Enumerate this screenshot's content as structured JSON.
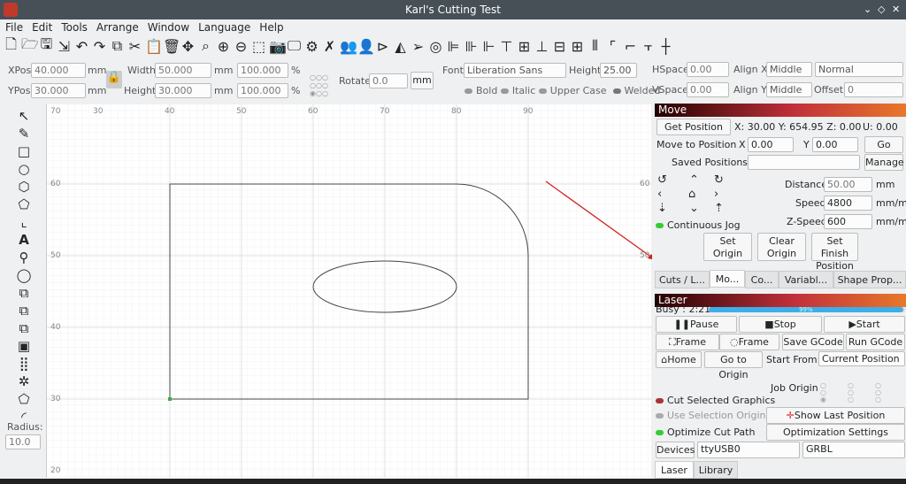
{
  "window": {
    "title": "Karl's Cutting Test"
  },
  "menu": [
    "File",
    "Edit",
    "Tools",
    "Arrange",
    "Window",
    "Language",
    "Help"
  ],
  "toolbar_icons": [
    "new-file-icon",
    "open-folder-icon",
    "save-icon",
    "import-icon",
    "undo-icon",
    "redo-icon",
    "copy-icon",
    "cut-icon",
    "paste-icon",
    "delete-icon",
    "move-icon",
    "zoom-icon",
    "zoom-in-icon",
    "zoom-out-icon",
    "frame-select-icon",
    "camera-icon",
    "monitor-icon",
    "settings-icon",
    "tools-icon",
    "group-icon",
    "user-icon",
    "flip-icon",
    "mirror-icon",
    "send-icon"
  ],
  "props": {
    "xpos_label": "XPos",
    "xpos": "40.000",
    "ypos_label": "YPos",
    "ypos": "30.000",
    "unit": "mm",
    "width_label": "Width",
    "width": "50.000",
    "height_label": "Height",
    "height": "30.000",
    "wpct": "100.000",
    "hpct": "100.000",
    "pct": "%",
    "rotate_label": "Rotate",
    "rotate": "0.0",
    "mm_button": "mm"
  },
  "text": {
    "font_label": "Font",
    "font": "Liberation Sans",
    "height_label": "Height",
    "height": "25.00",
    "hspace_label": "HSpace",
    "hspace": "0.00",
    "vspace_label": "VSpace",
    "vspace": "0.00",
    "alignx_label": "Align X",
    "alignx": "Middle",
    "aligny_label": "Align Y",
    "aligny": "Middle",
    "style": "Normal",
    "offset_label": "Offset",
    "offset": "0",
    "bold": "Bold",
    "italic": "Italic",
    "upper": "Upper Case",
    "welded": "Welded"
  },
  "ruler": {
    "x": [
      "40",
      "50",
      "60",
      "70",
      "80",
      "90"
    ],
    "x_left": "70",
    "x_left2": "30",
    "y": [
      "60",
      "50",
      "40",
      "30"
    ],
    "y_top": "70",
    "y_bottom": "20"
  },
  "left_tools": {
    "radius_label": "Radius:",
    "radius": "10.0"
  },
  "move": {
    "title": "Move",
    "get_position": "Get Position",
    "pos_readout": "X: 30.00   Y: 654.95 Z: 0.00",
    "u_readout": "U: 0.00",
    "move_to": "Move to Position",
    "x_label": "X",
    "x": "0.00",
    "y_label": "Y",
    "y": "0.00",
    "go": "Go",
    "saved_label": "Saved Positions:",
    "manage": "Manage",
    "distance_label": "Distance",
    "distance": "50.00",
    "speed_label": "Speed",
    "speed": "4800",
    "zspeed_label": "Z-Speed",
    "zspeed": "600",
    "unit_mm": "mm",
    "unit_speed": "mm/m",
    "continuous": "Continuous Jog",
    "set_origin": "Set Origin",
    "clear_origin": "Clear Origin",
    "set_finish": "Set Finish Position"
  },
  "tabs": [
    "Cuts / L...",
    "Mo...",
    "Co...",
    "Variabl...",
    "Shape Prop..."
  ],
  "laser": {
    "title": "Laser",
    "busy": "Busy : 2:21",
    "progress": 99,
    "progress_label": "99%",
    "pause": "Pause",
    "stop": "Stop",
    "start": "Start",
    "frame1": "Frame",
    "frame2": "Frame",
    "save_gcode": "Save GCode",
    "run_gcode": "Run GCode",
    "home": "Home",
    "go_origin": "Go to Origin",
    "start_from_label": "Start From:",
    "start_from": "Current Position",
    "job_origin": "Job Origin",
    "cut_selected": "Cut Selected Graphics",
    "use_selection": "Use Selection Origin",
    "optimize": "Optimize Cut Path",
    "show_last": "Show Last Position",
    "opt_settings": "Optimization Settings",
    "devices": "Devices",
    "port": "ttyUSB0",
    "controller": "GRBL"
  },
  "bottom_tabs": [
    "Laser",
    "Library"
  ],
  "colors": {
    "accent": "#3daee9",
    "arrow": "#d0201c"
  }
}
